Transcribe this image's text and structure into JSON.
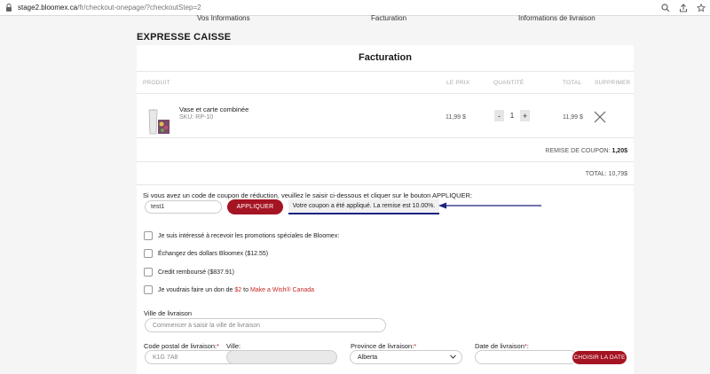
{
  "browser": {
    "url_host": "stage2.bloomex.ca",
    "url_path": "/fr/checkout-onepage/?checkoutStep=2"
  },
  "steps": [
    "Vos Informations",
    "Facturation",
    "Informations de livraison"
  ],
  "page_title": "EXPRESSE CAISSE",
  "card_title": "Facturation",
  "table": {
    "headers": {
      "product": "PRODUIT",
      "price": "LE PRIX",
      "quantity": "QUANTITÉ",
      "total": "TOTAL",
      "remove": "SUPPRIMER"
    },
    "item": {
      "name": "Vase et carte combinée",
      "sku": "SKU: RP-10",
      "price": "11,99 $",
      "qty_minus": "-",
      "qty": "1",
      "qty_plus": "+",
      "total": "11,99 $"
    }
  },
  "summary": {
    "discount_label": "REMISE DE COUPON:",
    "discount_value": "1,20$",
    "total": "TOTAL: 10,79$"
  },
  "coupon": {
    "instructions": "Si vous avez un code de coupon de réduction, veuillez le saisir ci-dessous et cliquer sur le bouton APPLIQUER:",
    "value": "test1",
    "apply_label": "APPLIQUER",
    "message": "Votre coupon a été appliqué. La remise est 10.00%.",
    "arrow_color": "#1a237e"
  },
  "options": {
    "promotions": "Je suis intéressé à recevoir les promotions spéciales de Bloomex:",
    "exchange": "Échangez des dollars Bloomex ($12.55)",
    "credit": "Credit remboursé ($837.91)",
    "donate_prefix": "Je voudrais faire un don de",
    "donate_amount": "$2",
    "donate_to": "to",
    "donate_org": "Make a Wish® Canada"
  },
  "delivery": {
    "city_label": "Ville de livraison",
    "city_placeholder": "Commencer à saisir la ville de livraison",
    "postal_label": "Code postal de livraison:",
    "postal_value": "K1G 7A8",
    "ville_label": "Ville:",
    "province_label": "Province de livraison:",
    "province_value": "Alberta",
    "date_label": "Date de livraison",
    "required_mark": "*",
    "date_button": "CHOISIR LA DATE"
  },
  "colors": {
    "accent": "#a51422",
    "link_red": "#c62828",
    "message_border": "#1a237e"
  }
}
